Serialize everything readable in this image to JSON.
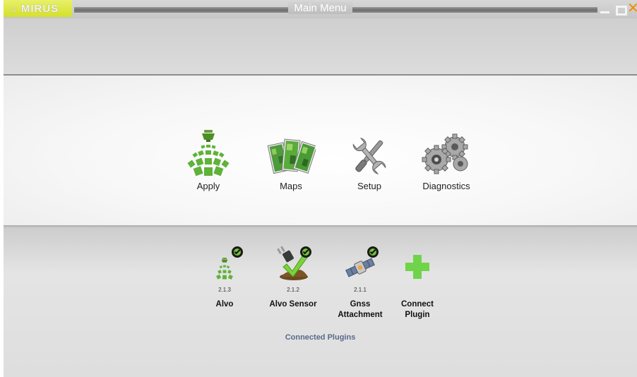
{
  "window": {
    "brand": "MIRUS",
    "title": "Main Menu",
    "controls": [
      "minimize",
      "maximize",
      "close"
    ]
  },
  "menu": {
    "items": [
      {
        "label": "Apply",
        "icon": "sprayer-icon"
      },
      {
        "label": "Maps",
        "icon": "maps-icon"
      },
      {
        "label": "Setup",
        "icon": "wrench-screwdriver-icon"
      },
      {
        "label": "Diagnostics",
        "icon": "gears-icon"
      }
    ]
  },
  "plugins": {
    "caption": "Connected Plugins",
    "items": [
      {
        "name": "Alvo",
        "version": "2.1.3",
        "connected": true,
        "icon": "sprayer-icon"
      },
      {
        "name": "Alvo Sensor",
        "version": "2.1.2",
        "connected": true,
        "icon": "plug-checkmark-icon"
      },
      {
        "name": "Gnss Attachment",
        "version": "2.1.1",
        "connected": true,
        "icon": "satellite-icon"
      },
      {
        "name": "Connect Plugin",
        "version": "",
        "connected": false,
        "icon": "plus-icon"
      }
    ]
  },
  "colors": {
    "brand_tab": "#d4e02a",
    "accent_green": "#6cbf3a",
    "close": "#f28c00",
    "caption": "#5a6a88"
  }
}
